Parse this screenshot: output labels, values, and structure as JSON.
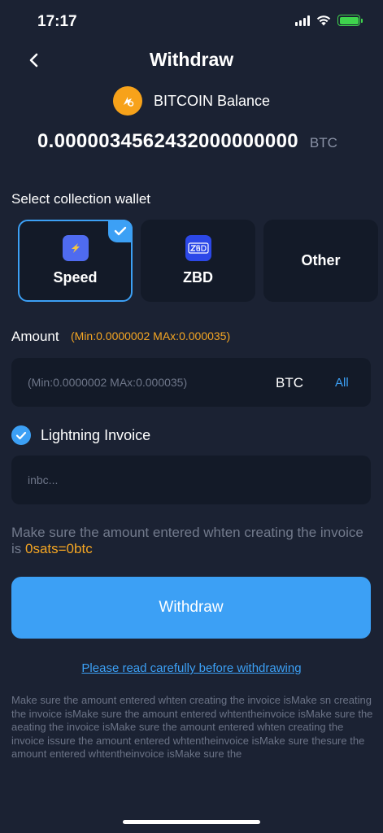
{
  "status_bar": {
    "time": "17:17"
  },
  "header": {
    "title": "Withdraw"
  },
  "balance": {
    "label": "BITCOIN Balance",
    "amount": "0.0000034562432000000000",
    "unit": "BTC"
  },
  "wallet_section": {
    "label": "Select collection wallet",
    "options": [
      {
        "label": "Speed",
        "selected": true
      },
      {
        "label": "ZBD",
        "selected": false
      },
      {
        "label": "Other",
        "selected": false
      }
    ]
  },
  "amount": {
    "label": "Amount",
    "hint": "(Min:0.0000002 MAx:0.000035)",
    "placeholder": "(Min:0.0000002 MAx:0.000035)",
    "unit": "BTC",
    "all_label": "All"
  },
  "invoice": {
    "label": "Lightning Invoice",
    "checked": true,
    "placeholder": "inbc..."
  },
  "note": {
    "text": "Make sure the amount entered whten creating the invoice is ",
    "highlight": "0sats=0btc"
  },
  "withdraw_button": {
    "label": "Withdraw"
  },
  "read_link": {
    "label": "Please read carefully before withdrawing"
  },
  "disclaimer": {
    "text": "Make sure the amount entered whten creating the invoice isMake sn creating the invoice isMake sure the amount entered whtentheinvoice isMake sure the aeating the invoice isMake sure the amount entered whten creating the invoice issure the amount entered whtentheinvoice isMake sure thesure the amount entered whtentheinvoice isMake sure the"
  },
  "colors": {
    "accent": "#3ca0f5",
    "highlight": "#f5a623",
    "background": "#1b2233",
    "card": "#131a28",
    "coin": "#f7a21a"
  }
}
